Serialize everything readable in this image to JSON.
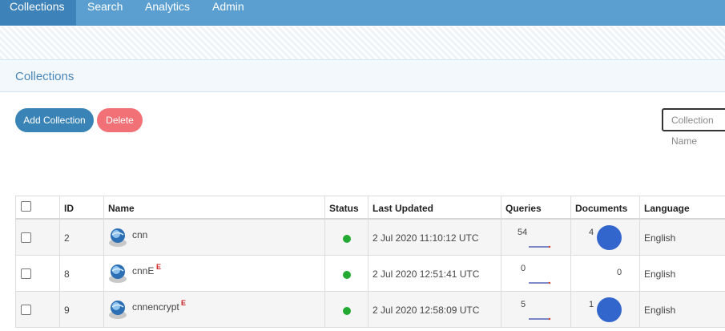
{
  "nav": {
    "items": [
      {
        "label": "Collections"
      },
      {
        "label": "Search"
      },
      {
        "label": "Analytics"
      },
      {
        "label": "Admin"
      }
    ]
  },
  "section": {
    "title": "Collections"
  },
  "toolbar": {
    "add_label": "Add Collection",
    "delete_label": "Delete",
    "search_placeholder": "Collection Name"
  },
  "table": {
    "headers": {
      "id": "ID",
      "name": "Name",
      "status": "Status",
      "updated": "Last Updated",
      "queries": "Queries",
      "documents": "Documents",
      "language": "Language"
    },
    "rows": [
      {
        "id": "2",
        "name": "cnn",
        "encrypted_mark": "",
        "updated": "2 Jul 2020 11:10:12 UTC",
        "queries": "54",
        "documents": "4",
        "language": "English"
      },
      {
        "id": "8",
        "name": "cnnE",
        "encrypted_mark": "E",
        "updated": "2 Jul 2020 12:51:41 UTC",
        "queries": "0",
        "documents": "0",
        "language": "English"
      },
      {
        "id": "9",
        "name": "cnnencrypt",
        "encrypted_mark": "E",
        "updated": "2 Jul 2020 12:58:09 UTC",
        "queries": "5",
        "documents": "1",
        "language": "English"
      }
    ]
  },
  "colors": {
    "nav_bg": "#5a9fd0",
    "accent": "#3a83b6",
    "delete": "#f17176",
    "status_ok": "#22aa33",
    "bubble": "#3366cc"
  }
}
